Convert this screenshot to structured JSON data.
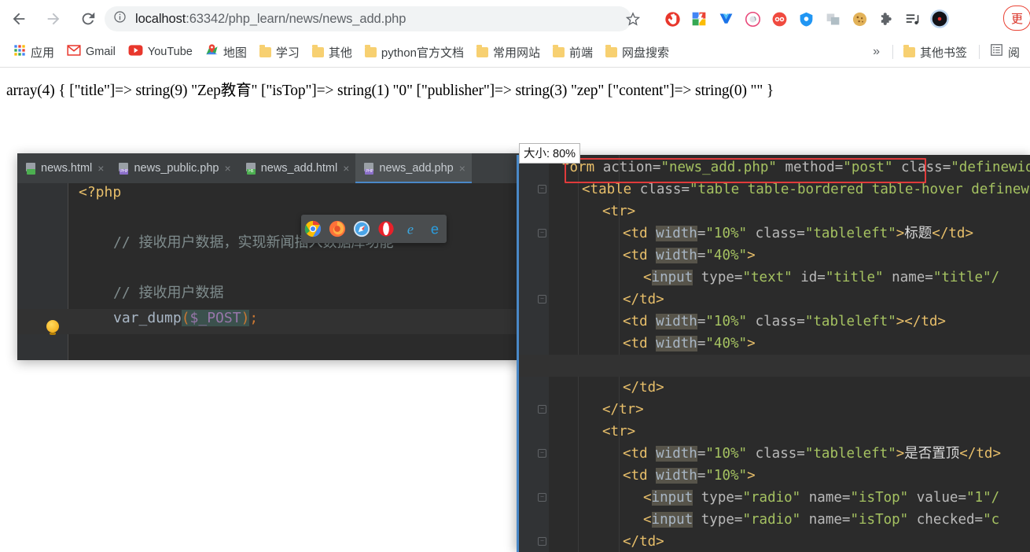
{
  "browser": {
    "nav": {
      "back": "back-arrow",
      "forward": "forward-arrow",
      "reload": "reload"
    },
    "omnibox": {
      "info_icon": "site-info-icon",
      "host": "localhost",
      "path": ":63342/php_learn/news/news_add.php",
      "full_url": "localhost:63342/php_learn/news/news_add.php",
      "star_icon": "bookmark-star-icon"
    },
    "extensions": [
      {
        "name": "adblock-extension-icon",
        "color": "#e8372c"
      },
      {
        "name": "colorful-extension-icon",
        "color": "#4285f4"
      },
      {
        "name": "v-extension-icon",
        "color": "#1a73e8"
      },
      {
        "name": "circle-extension-icon",
        "color": "#e8487a"
      },
      {
        "name": "infinity-extension-icon",
        "color": "#f04a3f"
      },
      {
        "name": "shield-extension-icon",
        "color": "#2196f3"
      },
      {
        "name": "translate-extension-icon",
        "color": "#b0bec5"
      },
      {
        "name": "cookie-extension-icon",
        "color": "#e8b84b"
      },
      {
        "name": "puzzle-extensions-icon",
        "color": "#5f6368"
      },
      {
        "name": "playlist-extension-icon",
        "color": "#3c4043"
      },
      {
        "name": "profile-avatar",
        "color": "#1a1a2e"
      }
    ],
    "update_pill": {
      "label": "更",
      "color": "#d93025"
    },
    "bookmarks": [
      {
        "label": "应用",
        "icon": "apps-grid-icon"
      },
      {
        "label": "Gmail",
        "icon": "gmail-icon"
      },
      {
        "label": "YouTube",
        "icon": "youtube-icon"
      },
      {
        "label": "地图",
        "icon": "maps-icon"
      },
      {
        "label": "学习",
        "icon": "folder-icon"
      },
      {
        "label": "其他",
        "icon": "folder-icon"
      },
      {
        "label": "python官方文档",
        "icon": "folder-icon"
      },
      {
        "label": "常用网站",
        "icon": "folder-icon"
      },
      {
        "label": "前端",
        "icon": "folder-icon"
      },
      {
        "label": "网盘搜索",
        "icon": "folder-icon"
      }
    ],
    "bookmarks_overflow": "»",
    "other_bookmarks": {
      "label": "其他书签",
      "icon": "folder-icon"
    },
    "reading_list": {
      "label": "阅",
      "icon": "reading-list-icon"
    }
  },
  "page": {
    "var_dump_output": "array(4) { [\"title\"]=> string(9) \"Zep教育\" [\"isTop\"]=> string(1) \"0\" [\"publisher\"]=> string(3) \"zep\" [\"content\"]=> string(0) \"\" }"
  },
  "ide_left": {
    "tabs": [
      {
        "label": "news.html",
        "badge": "",
        "badge_color": "#4caf50",
        "active": false,
        "close": "×"
      },
      {
        "label": "news_public.php",
        "badge": "PHP",
        "badge_color": "#8b6fc9",
        "active": false,
        "close": "×"
      },
      {
        "label": "news_add.html",
        "badge": "H5",
        "badge_color": "#4caf50",
        "active": false,
        "close": "×"
      },
      {
        "label": "news_add.php",
        "badge": "PHP",
        "badge_color": "#8b6fc9",
        "active": true,
        "close": "×"
      }
    ],
    "code_lines": [
      "<?php",
      "",
      "    // 接收用户数据，实现新闻插入数据库功能",
      "",
      "    // 接收用户数据",
      "    var_dump($_POST);"
    ],
    "php_open_tag": "<?php",
    "comment_1": "// 接收用户数据，实现新闻插入数据库功能",
    "comment_2": "// 接收用户数据",
    "fn_name": "var_dump",
    "fn_arg": "$_POST",
    "gutter_hint_icon": "lightbulb-intention-icon"
  },
  "browser_popup": {
    "icons": [
      {
        "name": "chrome-browser-icon"
      },
      {
        "name": "firefox-browser-icon"
      },
      {
        "name": "safari-browser-icon"
      },
      {
        "name": "opera-browser-icon"
      },
      {
        "name": "internet-explorer-browser-icon"
      },
      {
        "name": "edge-browser-icon"
      }
    ]
  },
  "size_tooltip": {
    "label": "大小: 80%"
  },
  "ide_right": {
    "lines": [
      {
        "indent": 0,
        "parts": [
          {
            "t": "form ",
            "c": "tg"
          },
          {
            "t": "action",
            "c": "at"
          },
          {
            "t": "=",
            "c": "at"
          },
          {
            "t": "\"news_add.php\"",
            "c": "vl"
          },
          {
            "t": " method",
            "c": "at"
          },
          {
            "t": "=",
            "c": "at"
          },
          {
            "t": "\"post\"",
            "c": "vl"
          },
          {
            "t": " class",
            "c": "at"
          },
          {
            "t": "=",
            "c": "at"
          },
          {
            "t": "\"definewidt",
            "c": "vl"
          }
        ]
      },
      {
        "indent": 1,
        "parts": [
          {
            "t": "<table ",
            "c": "tg"
          },
          {
            "t": "class",
            "c": "at"
          },
          {
            "t": "=",
            "c": "at"
          },
          {
            "t": "\"table table-bordered table-hover definewi",
            "c": "vl"
          }
        ]
      },
      {
        "indent": 2,
        "parts": [
          {
            "t": "<tr>",
            "c": "tg"
          }
        ]
      },
      {
        "indent": 3,
        "parts": [
          {
            "t": "<td ",
            "c": "tg"
          },
          {
            "t": "width",
            "c": "hl"
          },
          {
            "t": "=",
            "c": "at"
          },
          {
            "t": "\"10%\"",
            "c": "vl"
          },
          {
            "t": " class",
            "c": "at"
          },
          {
            "t": "=",
            "c": "at"
          },
          {
            "t": "\"tableleft\"",
            "c": "vl"
          },
          {
            "t": ">",
            "c": "tg"
          },
          {
            "t": "标题",
            "c": "cn"
          },
          {
            "t": "</td>",
            "c": "tg"
          }
        ]
      },
      {
        "indent": 3,
        "parts": [
          {
            "t": "<td ",
            "c": "tg"
          },
          {
            "t": "width",
            "c": "hl"
          },
          {
            "t": "=",
            "c": "at"
          },
          {
            "t": "\"40%\"",
            "c": "vl"
          },
          {
            "t": ">",
            "c": "tg"
          }
        ]
      },
      {
        "indent": 4,
        "parts": [
          {
            "t": "<",
            "c": "tg"
          },
          {
            "t": "input",
            "c": "hl"
          },
          {
            "t": " type",
            "c": "at"
          },
          {
            "t": "=",
            "c": "at"
          },
          {
            "t": "\"text\"",
            "c": "vl"
          },
          {
            "t": " id",
            "c": "at"
          },
          {
            "t": "=",
            "c": "at"
          },
          {
            "t": "\"title\"",
            "c": "vl"
          },
          {
            "t": " name",
            "c": "at"
          },
          {
            "t": "=",
            "c": "at"
          },
          {
            "t": "\"title\"/",
            "c": "vl"
          }
        ]
      },
      {
        "indent": 3,
        "parts": [
          {
            "t": "</td>",
            "c": "tg"
          }
        ]
      },
      {
        "indent": 3,
        "parts": [
          {
            "t": "<td ",
            "c": "tg"
          },
          {
            "t": "width",
            "c": "hl"
          },
          {
            "t": "=",
            "c": "at"
          },
          {
            "t": "\"10%\"",
            "c": "vl"
          },
          {
            "t": " class",
            "c": "at"
          },
          {
            "t": "=",
            "c": "at"
          },
          {
            "t": "\"tableleft\"",
            "c": "vl"
          },
          {
            "t": "></td>",
            "c": "tg"
          }
        ]
      },
      {
        "indent": 3,
        "parts": [
          {
            "t": "<td ",
            "c": "tg"
          },
          {
            "t": "width",
            "c": "hl"
          },
          {
            "t": "=",
            "c": "at"
          },
          {
            "t": "\"40%\"",
            "c": "vl"
          },
          {
            "t": ">",
            "c": "tg"
          }
        ]
      },
      {
        "indent": 0,
        "parts": []
      },
      {
        "indent": 3,
        "parts": [
          {
            "t": "</td>",
            "c": "tg"
          }
        ]
      },
      {
        "indent": 2,
        "parts": [
          {
            "t": "</tr>",
            "c": "tg"
          }
        ]
      },
      {
        "indent": 2,
        "parts": [
          {
            "t": "<tr>",
            "c": "tg"
          }
        ]
      },
      {
        "indent": 3,
        "parts": [
          {
            "t": "<td ",
            "c": "tg"
          },
          {
            "t": "width",
            "c": "hl"
          },
          {
            "t": "=",
            "c": "at"
          },
          {
            "t": "\"10%\"",
            "c": "vl"
          },
          {
            "t": " class",
            "c": "at"
          },
          {
            "t": "=",
            "c": "at"
          },
          {
            "t": "\"tableleft\"",
            "c": "vl"
          },
          {
            "t": ">",
            "c": "tg"
          },
          {
            "t": "是否置顶",
            "c": "cn"
          },
          {
            "t": "</td>",
            "c": "tg"
          }
        ]
      },
      {
        "indent": 3,
        "parts": [
          {
            "t": "<td ",
            "c": "tg"
          },
          {
            "t": "width",
            "c": "hl"
          },
          {
            "t": "=",
            "c": "at"
          },
          {
            "t": "\"10%\"",
            "c": "vl"
          },
          {
            "t": ">",
            "c": "tg"
          }
        ]
      },
      {
        "indent": 4,
        "parts": [
          {
            "t": "<",
            "c": "tg"
          },
          {
            "t": "input",
            "c": "hl"
          },
          {
            "t": " type",
            "c": "at"
          },
          {
            "t": "=",
            "c": "at"
          },
          {
            "t": "\"radio\"",
            "c": "vl"
          },
          {
            "t": " name",
            "c": "at"
          },
          {
            "t": "=",
            "c": "at"
          },
          {
            "t": "\"isTop\"",
            "c": "vl"
          },
          {
            "t": " value",
            "c": "at"
          },
          {
            "t": "=",
            "c": "at"
          },
          {
            "t": "\"1\"/",
            "c": "vl"
          }
        ]
      },
      {
        "indent": 4,
        "parts": [
          {
            "t": "<",
            "c": "tg"
          },
          {
            "t": "input",
            "c": "hl"
          },
          {
            "t": " type",
            "c": "at"
          },
          {
            "t": "=",
            "c": "at"
          },
          {
            "t": "\"radio\"",
            "c": "vl"
          },
          {
            "t": " name",
            "c": "at"
          },
          {
            "t": "=",
            "c": "at"
          },
          {
            "t": "\"isTop\"",
            "c": "vl"
          },
          {
            "t": " checked",
            "c": "at"
          },
          {
            "t": "=",
            "c": "at"
          },
          {
            "t": "\"c",
            "c": "vl"
          }
        ]
      },
      {
        "indent": 3,
        "parts": [
          {
            "t": "</td>",
            "c": "tg"
          }
        ]
      }
    ],
    "highlight_box": "form-action-method-highlight"
  },
  "colors": {
    "editor_bg": "#2b2b2b",
    "gutter_bg": "#313335",
    "tabbar_bg": "#3c3f41",
    "accent_blue": "#4a88c7",
    "tag_orange": "#e8bf6a",
    "string_green": "#a5c261",
    "comment_gray": "#7f8c8d",
    "variable_purple": "#9876aa",
    "red_highlight": "#e03b3b"
  }
}
